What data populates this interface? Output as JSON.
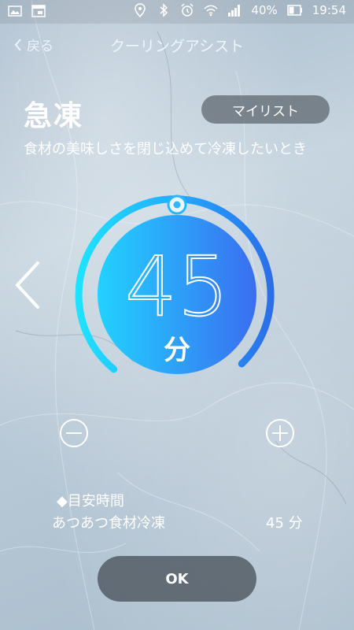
{
  "status_bar": {
    "battery_percent": "40%",
    "time": "19:54",
    "icons": [
      "image-icon",
      "calendar-icon",
      "location-icon",
      "bluetooth-icon",
      "alarm-icon",
      "wifi-icon",
      "signal-icon",
      "battery-icon"
    ]
  },
  "header": {
    "back_label": "戻る",
    "title": "クーリングアシスト"
  },
  "mode": {
    "name": "急凍",
    "mylist_label": "マイリスト",
    "description": "食材の美味しさを閉じ込めて冷凍したいとき"
  },
  "timer": {
    "value": "45",
    "unit": "分",
    "level_fraction": 0.45
  },
  "estimate": {
    "heading": "◆目安時間",
    "item_name": "あつあつ食材冷凍",
    "item_value": "45 分"
  },
  "footer": {
    "ok_label": "OK"
  },
  "colors": {
    "accent_cyan": "#1fd0ff",
    "accent_blue": "#2e7ff0",
    "pill_bg": "#505860"
  }
}
